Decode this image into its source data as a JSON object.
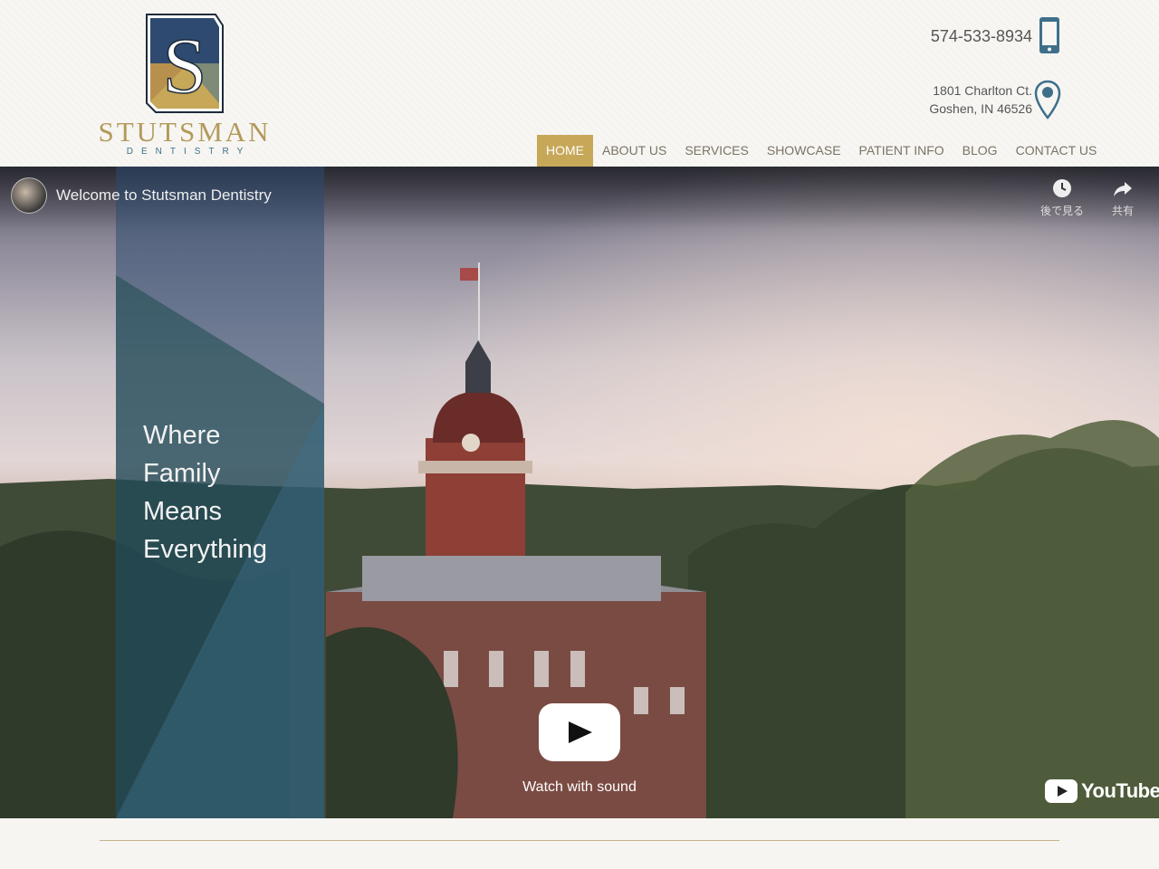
{
  "brand": {
    "name": "STUTSMAN",
    "sub": "DENTISTRY",
    "mark_letter": "S",
    "colors": {
      "gold": "#c7a758",
      "navy": "#2e4a70",
      "teal": "#3e6f8a",
      "dark": "#1d2b3a"
    }
  },
  "contact": {
    "phone": "574-533-8934",
    "address_line1": "1801 Charlton Ct.",
    "address_line2": "Goshen, IN 46526",
    "phone_icon": "mobile-phone-icon",
    "address_icon": "map-pin-icon"
  },
  "nav": {
    "items": [
      {
        "label": "HOME",
        "active": true
      },
      {
        "label": "ABOUT US",
        "active": false
      },
      {
        "label": "SERVICES",
        "active": false
      },
      {
        "label": "SHOWCASE",
        "active": false
      },
      {
        "label": "PATIENT INFO",
        "active": false
      },
      {
        "label": "BLOG",
        "active": false
      },
      {
        "label": "CONTACT US",
        "active": false
      }
    ]
  },
  "video": {
    "title": "Welcome to Stutsman Dentistry",
    "watch_later_label": "後で見る",
    "share_label": "共有",
    "watch_with_sound": "Watch with sound",
    "youtube_label": "YouTube"
  },
  "hero": {
    "tagline": [
      "Where",
      "Family",
      "Means",
      "Everything"
    ]
  }
}
